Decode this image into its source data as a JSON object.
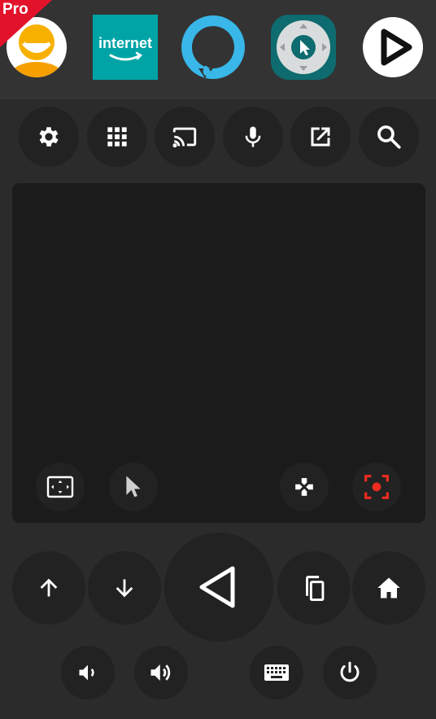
{
  "ribbon": {
    "label": "Pro",
    "color": "#e3122b"
  },
  "apps": [
    {
      "name": "avatar",
      "icon": "smiling-avatar-icon",
      "bg": "#f5a000"
    },
    {
      "name": "internet",
      "label": "internet",
      "icon": "amazon-smile-icon",
      "bg": "#00a4a6"
    },
    {
      "name": "alexa",
      "icon": "alexa-ring-icon",
      "color": "#38b7e8"
    },
    {
      "name": "mouse-toggle",
      "icon": "dpad-cursor-icon",
      "bg": "#0e6b6f"
    },
    {
      "name": "play",
      "icon": "play-icon"
    }
  ],
  "toolbar": [
    {
      "icon": "gear-icon"
    },
    {
      "icon": "apps-grid-icon"
    },
    {
      "icon": "cast-icon"
    },
    {
      "icon": "microphone-icon"
    },
    {
      "icon": "open-external-icon"
    },
    {
      "icon": "search-icon"
    }
  ],
  "touchpad_tools": [
    {
      "icon": "fullscreen-icon"
    },
    {
      "icon": "cursor-pointer-icon"
    },
    {
      "icon": "gamepad-icon"
    },
    {
      "icon": "screen-record-icon",
      "color": "#ee2b1f"
    }
  ],
  "nav": [
    {
      "icon": "arrow-up-icon"
    },
    {
      "icon": "arrow-down-icon"
    },
    {
      "icon": "back-triangle-icon"
    },
    {
      "icon": "copy-icon"
    },
    {
      "icon": "home-icon"
    }
  ],
  "bottom": [
    {
      "icon": "volume-down-icon"
    },
    {
      "icon": "volume-up-icon"
    },
    {
      "icon": "keyboard-icon"
    },
    {
      "icon": "power-icon"
    }
  ]
}
